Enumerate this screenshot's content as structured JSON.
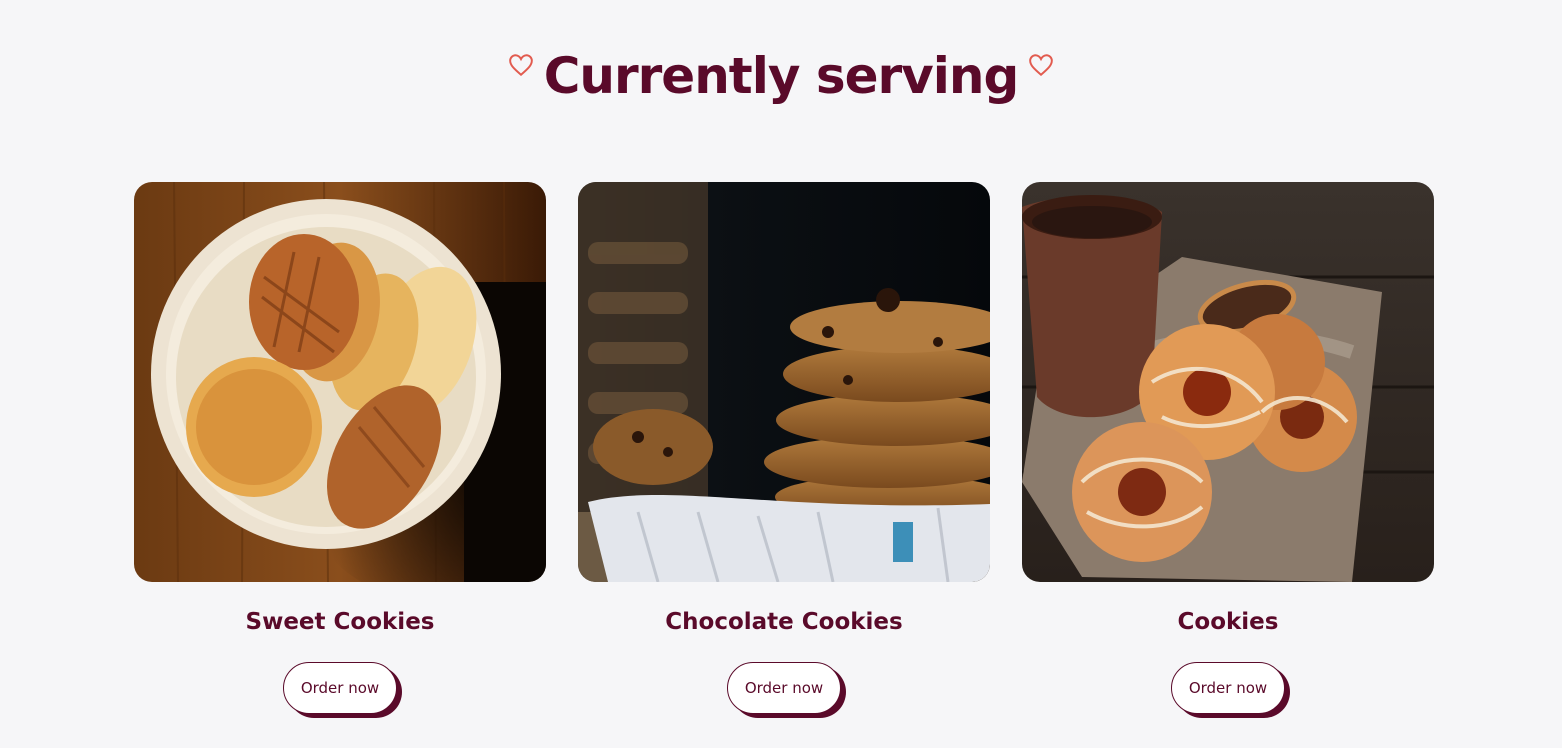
{
  "section": {
    "title": "Currently serving",
    "heart_icon_color": "#e25b4f",
    "title_color": "#5a0a2a"
  },
  "cards": [
    {
      "title": "Sweet Cookies",
      "button_label": "Order now",
      "image": "bowl-of-cookies-photo"
    },
    {
      "title": "Chocolate Cookies",
      "button_label": "Order now",
      "image": "stack-of-chocolate-chip-cookies-photo"
    },
    {
      "title": "Cookies",
      "button_label": "Order now",
      "image": "jam-cookies-with-clay-cup-photo"
    }
  ]
}
